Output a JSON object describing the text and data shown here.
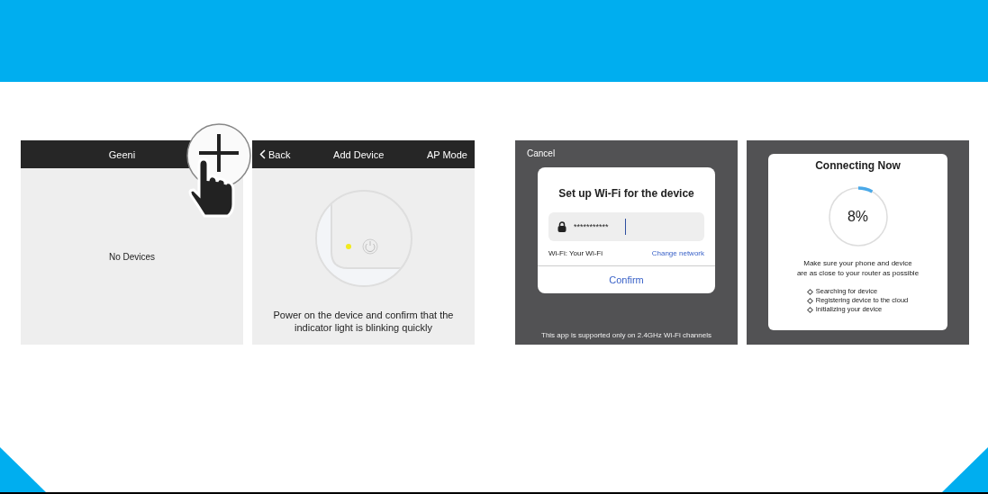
{
  "screens": [
    {
      "kind": "home",
      "title": "Geeni",
      "empty_text": "No Devices"
    },
    {
      "kind": "add_device",
      "back": "Back",
      "title": "Add Device",
      "action": "AP Mode",
      "instruction": "Power on the device and confirm that the indicator light is blinking quickly"
    },
    {
      "kind": "wifi",
      "cancel": "Cancel",
      "dialog_title": "Set up Wi-Fi for the device",
      "password": "***********",
      "network": "Wi-Fi: Your Wi-Fi",
      "change_link": "Change network",
      "confirm": "Confirm",
      "note": "This app is supported only on 2.4GHz Wi-Fi channels"
    },
    {
      "kind": "connecting",
      "title": "Connecting Now",
      "progress_text": "8%",
      "level": 0.08,
      "hint": "Make sure your phone and device\nare as close to your router as possible",
      "steps": [
        "Searching for device",
        "Registering device to the cloud",
        "Initializing your device"
      ]
    }
  ]
}
